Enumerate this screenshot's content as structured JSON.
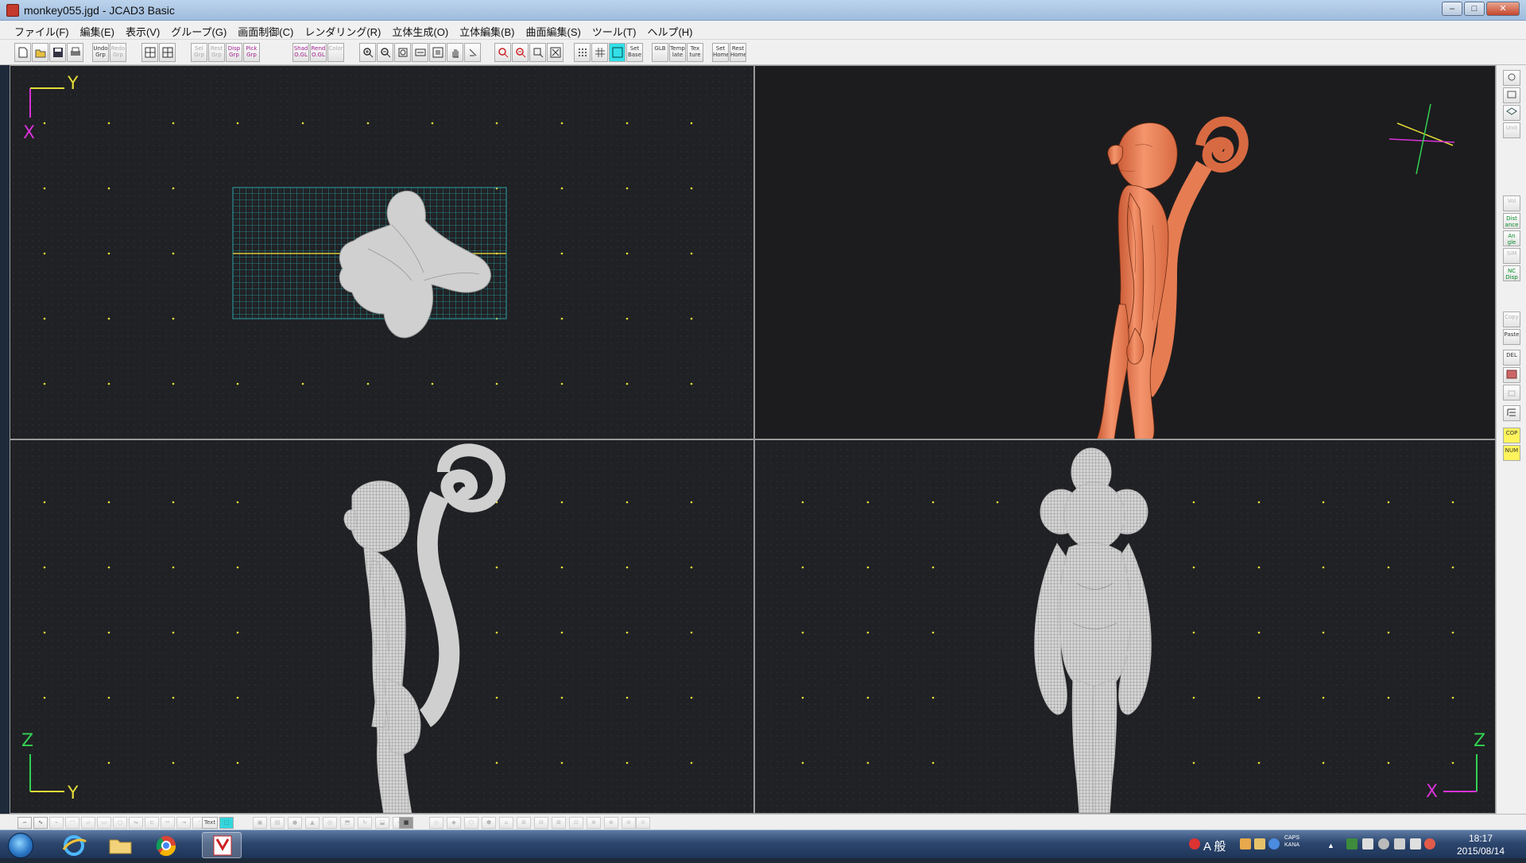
{
  "window": {
    "title": "monkey055.jgd - JCAD3 Basic",
    "controls": [
      "minimize",
      "maximize",
      "close"
    ]
  },
  "menu": [
    "ファイル(F)",
    "編集(E)",
    "表示(V)",
    "グループ(G)",
    "画面制御(C)",
    "レンダリング(R)",
    "立体生成(O)",
    "立体編集(B)",
    "曲面編集(S)",
    "ツール(T)",
    "ヘルプ(H)"
  ],
  "toolbar": {
    "file_buttons": [
      "new-file",
      "open-file",
      "save-file",
      "print"
    ],
    "undo": "Undo Grp",
    "redo": "Redo Grp",
    "sel_grp": "Sel Grp",
    "rest_grp": "Rest Grp",
    "disp_grp": "Disp Grp",
    "pick_grp": "Pick Grp",
    "shad_ogl": "Shad O.GL",
    "rend_ogl": "Rend O.GL",
    "color": "Color",
    "set_base": "Set Base",
    "glb": "GLB",
    "temp_late": "Temp late",
    "tex_ture": "Tex ture",
    "set_home": "Set Home",
    "rest_home": "Rest Home"
  },
  "viewports": {
    "top": {
      "axis_v": "Y",
      "axis_h": "X"
    },
    "perspective": {},
    "side": {
      "axis_v": "Z",
      "axis_h": "Y"
    },
    "front": {
      "axis_v": "Z",
      "axis_h": "X"
    }
  },
  "right_toolbar": {
    "vol": "Vol",
    "distance": "Dist ance",
    "angle": "An gle",
    "sim": "SIM",
    "nc_disp": "NC Disp",
    "copy": "Copy",
    "paste": "Paste",
    "del": "DEL",
    "cop": "COP",
    "num": "NUM"
  },
  "bottom_toolbar": {
    "text": "Text"
  },
  "taskbar": {
    "apps": [
      "internet-explorer",
      "file-explorer",
      "chrome",
      "jcad3"
    ],
    "ime_mode": "A 般",
    "caps": "CAPS",
    "kana": "KANA",
    "time": "18:17",
    "date": "2015/08/14"
  },
  "colors": {
    "accent_titlebar": "#9fbcdd",
    "viewport_bg": "#1c1c1e",
    "grid_dot": "#e5e03a",
    "wireframe": "#d4d4d4",
    "render_model": "#f0855e",
    "top_grid": "#2aa2aa",
    "axis_yellow": "#e4dc38",
    "axis_magenta": "#d832d8",
    "axis_green": "#32d252"
  }
}
